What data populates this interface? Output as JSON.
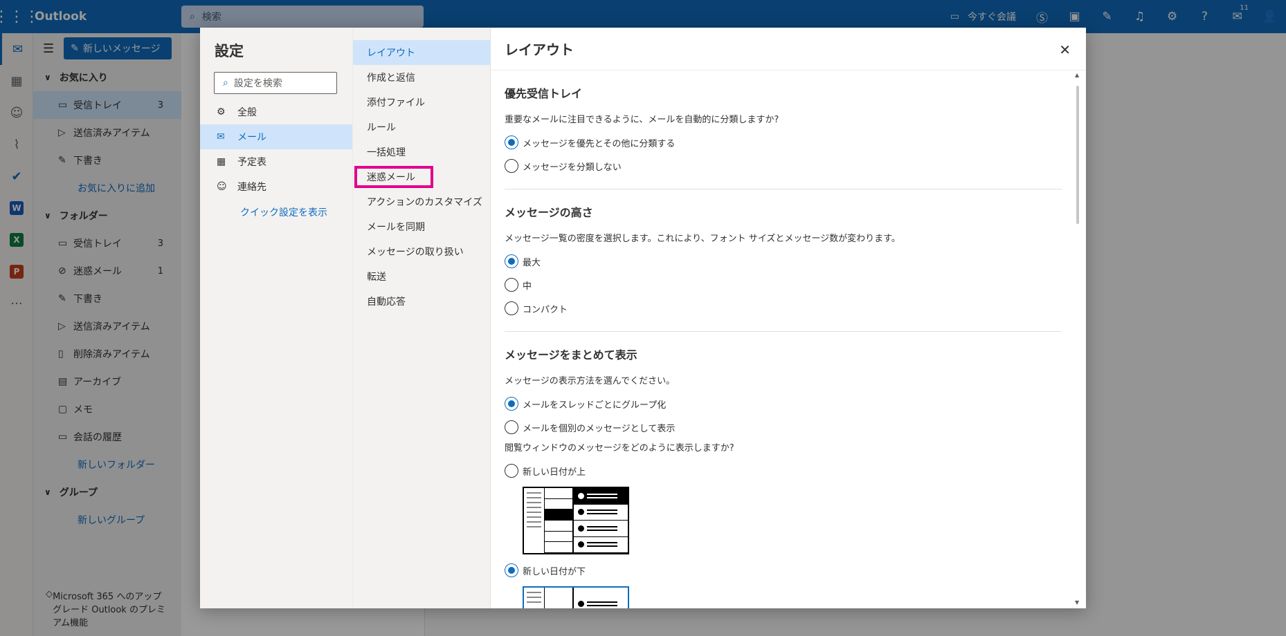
{
  "app": {
    "name": "Outlook"
  },
  "search": {
    "placeholder": "検索"
  },
  "topbar": {
    "meet_now": "今すぐ会議",
    "notification_count": "11"
  },
  "nav": {
    "new_message": "新しいメッセージ",
    "favorites": "お気に入り",
    "fav_items": [
      {
        "label": "受信トレイ",
        "count": "3"
      },
      {
        "label": "送信済みアイテム"
      },
      {
        "label": "下書き"
      }
    ],
    "add_favorite": "お気に入りに追加",
    "folders": "フォルダー",
    "folder_items": [
      {
        "label": "受信トレイ",
        "count": "3"
      },
      {
        "label": "迷惑メール",
        "count": "1"
      },
      {
        "label": "下書き"
      },
      {
        "label": "送信済みアイテム"
      },
      {
        "label": "削除済みアイテム"
      },
      {
        "label": "アーカイブ"
      },
      {
        "label": "メモ"
      },
      {
        "label": "会話の履歴"
      }
    ],
    "new_folder": "新しいフォルダー",
    "groups": "グループ",
    "new_group": "新しいグループ",
    "upgrade": "Microsoft 365 へのアップグレード Outlook のプレミアム機能"
  },
  "settings": {
    "title": "設定",
    "search_placeholder": "設定を検索",
    "categories": [
      {
        "label": "全般",
        "icon": "gear-icon"
      },
      {
        "label": "メール",
        "icon": "mail-icon"
      },
      {
        "label": "予定表",
        "icon": "calendar-icon"
      },
      {
        "label": "連絡先",
        "icon": "people-icon"
      }
    ],
    "quick_settings": "クイック設定を表示",
    "subcategories": [
      "レイアウト",
      "作成と返信",
      "添付ファイル",
      "ルール",
      "一括処理",
      "迷惑メール",
      "アクションのカスタマイズ",
      "メールを同期",
      "メッセージの取り扱い",
      "転送",
      "自動応答"
    ],
    "highlight_color": "#e3008c"
  },
  "pane": {
    "title": "レイアウト",
    "focused": {
      "heading": "優先受信トレイ",
      "desc": "重要なメールに注目できるように、メールを自動的に分類しますか?",
      "options": [
        "メッセージを優先とその他に分類する",
        "メッセージを分類しない"
      ],
      "selected": 0
    },
    "height": {
      "heading": "メッセージの高さ",
      "desc": "メッセージ一覧の密度を選択します。これにより、フォント サイズとメッセージ数が変わります。",
      "options": [
        "最大",
        "中",
        "コンパクト"
      ],
      "selected": 0
    },
    "conversation": {
      "heading": "メッセージをまとめて表示",
      "desc": "メッセージの表示方法を選んでください。",
      "options": [
        "メールをスレッドごとにグループ化",
        "メールを個別のメッセージとして表示"
      ],
      "selected": 0,
      "order_q": "閲覧ウィンドウのメッセージをどのように表示しますか?",
      "order_options": [
        "新しい日付が上",
        "新しい日付が下"
      ],
      "order_selected": 1
    }
  },
  "colors": {
    "accent": "#0f6cbd",
    "selected_bg": "#cfe4fa"
  }
}
